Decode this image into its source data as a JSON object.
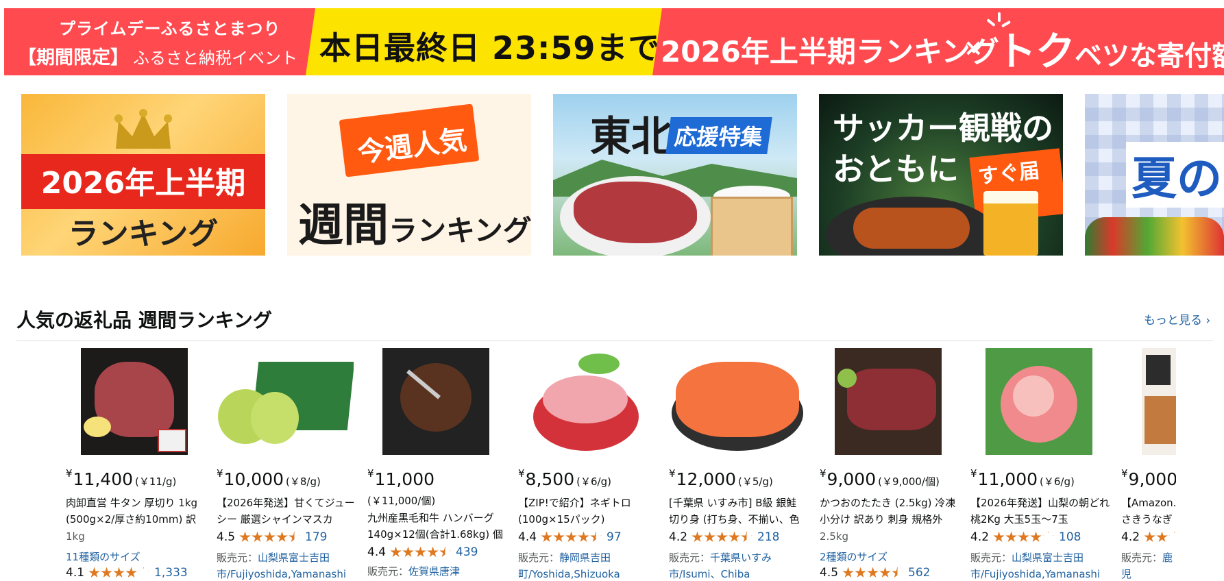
{
  "hero": {
    "line1": "プライムデーふるさとまつり",
    "line2_bracket": "【期間限定】",
    "line2_text": "ふるさと納税イベント",
    "deadline": "本日最終日 23:59まで",
    "ranking": "2026年上半期ランキング",
    "times": "×",
    "toku": "トク",
    "toku_rest": "ベツな寄付額",
    "colors": {
      "red": "#ff4a4f",
      "yellow": "#fde400"
    }
  },
  "tiles": [
    {
      "ribbon": "2026年上半期",
      "sub": "ランキング"
    },
    {
      "tag": "今週人気",
      "big": "週間",
      "big_rest": "ランキング"
    },
    {
      "title": "東北",
      "badge": "応援特集"
    },
    {
      "line1": "サッカー観戦の",
      "line2": "おともに",
      "badge": "すぐ届く"
    },
    {
      "title": "夏の"
    }
  ],
  "section": {
    "title": "人気の返礼品 週間ランキング",
    "see_more": "もっと見る ›"
  },
  "products": [
    {
      "yen": "¥",
      "price": "11,400",
      "unit": "(￥11/g)",
      "title": "肉卸直営 牛タン 厚切り 1kg (500g×2/厚さ約10mm) 訳",
      "size": "1kg",
      "variants": "11種類のサイズ",
      "rating": "4.1",
      "stars": [
        1,
        1,
        1,
        1,
        0
      ],
      "count": "1,333"
    },
    {
      "yen": "¥",
      "price": "10,000",
      "unit": "(￥8/g)",
      "title": "【2026年発送】甘くてジューシー 厳選シャインマスカ",
      "rating": "4.5",
      "stars": [
        1,
        1,
        1,
        1,
        0.5
      ],
      "count": "179",
      "seller_label": "販売元：",
      "seller": "山梨県富士吉田市/Fujiyoshida,Yamanashi"
    },
    {
      "yen": "¥",
      "price": "11,000",
      "unit": "",
      "unit_line": "(￥11,000/個)",
      "title": "九州産黒毛和牛 ハンバーグ 140g×12個(合計1.68kg) 個",
      "rating": "4.4",
      "stars": [
        1,
        1,
        1,
        1,
        0.5
      ],
      "count": "439",
      "seller_label": "販売元：",
      "seller": "佐賀県唐津"
    },
    {
      "yen": "¥",
      "price": "8,500",
      "unit": "(￥6/g)",
      "title": "【ZIP!で紹介】ネギトロ (100g×15パック)",
      "rating": "4.4",
      "stars": [
        1,
        1,
        1,
        1,
        0.5
      ],
      "count": "97",
      "seller_label": "販売元：",
      "seller": "静岡県吉田町/Yoshida,Shizuoka"
    },
    {
      "yen": "¥",
      "price": "12,000",
      "unit": "(￥5/g)",
      "title": "[千葉県 いすみ市] B級 銀鮭 切り身 (打ち身、不揃い、色",
      "rating": "4.2",
      "stars": [
        1,
        1,
        1,
        1,
        0.5
      ],
      "count": "218",
      "seller_label": "販売元：",
      "seller": "千葉県いすみ市/Isumi、Chiba"
    },
    {
      "yen": "¥",
      "price": "9,000",
      "unit": "(￥9,000/個)",
      "title": "かつおのたたき (2.5kg) 冷凍 小分け 訳あり 刺身 規格外",
      "size": "2.5kg",
      "variants": "2種類のサイズ",
      "rating": "4.5",
      "stars": [
        1,
        1,
        1,
        1,
        0.5
      ],
      "count": "562"
    },
    {
      "yen": "¥",
      "price": "11,000",
      "unit": "(￥6/g)",
      "title": "【2026年発送】山梨の朝どれ桃2Kg 大玉5玉～7玉",
      "rating": "4.2",
      "stars": [
        1,
        1,
        1,
        1,
        0
      ],
      "count": "108",
      "seller_label": "販売元：",
      "seller": "山梨県富士吉田市/Fujiyoshida,Yamanashi"
    },
    {
      "yen": "¥",
      "price": "9,000",
      "unit": "",
      "title": "【Amazon... さきうなぎ",
      "rating": "4.2",
      "stars": [
        1,
        1,
        0,
        0,
        0
      ],
      "count": "",
      "seller_label": "販売元：",
      "seller": "鹿児 町/Osaki,Ka"
    }
  ]
}
